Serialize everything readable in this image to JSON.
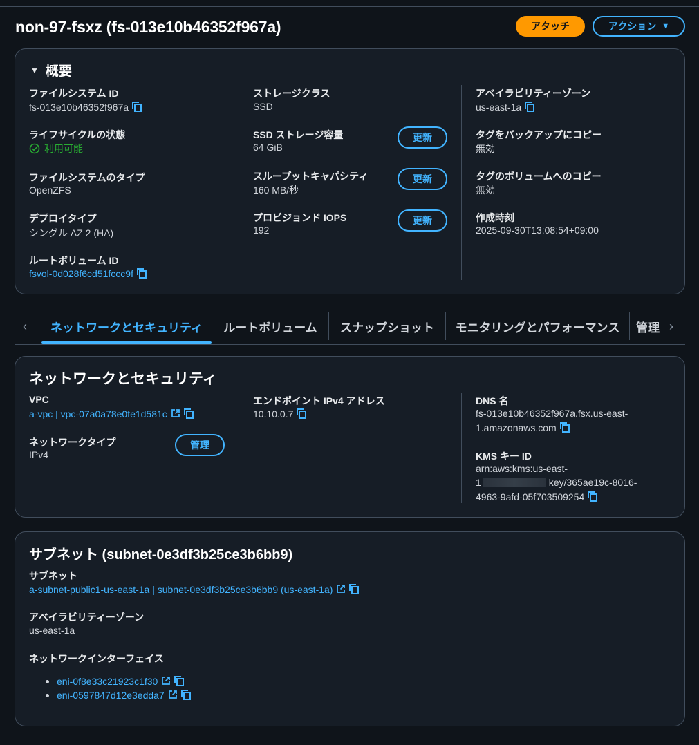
{
  "header": {
    "title": "non-97-fsxz (fs-013e10b46352f967a)",
    "attach_label": "アタッチ",
    "actions_label": "アクション"
  },
  "summary": {
    "heading": "概要",
    "col1": {
      "fs_id_label": "ファイルシステム ID",
      "fs_id_value": "fs-013e10b46352f967a",
      "lifecycle_label": "ライフサイクルの状態",
      "lifecycle_value": "利用可能",
      "fs_type_label": "ファイルシステムのタイプ",
      "fs_type_value": "OpenZFS",
      "deploy_label": "デプロイタイプ",
      "deploy_value": "シングル AZ 2 (HA)",
      "root_vol_label": "ルートボリューム ID",
      "root_vol_value": "fsvol-0d028f6cd51fccc9f"
    },
    "col2": {
      "storage_class_label": "ストレージクラス",
      "storage_class_value": "SSD",
      "ssd_capacity_label": "SSD ストレージ容量",
      "ssd_capacity_value": "64 GiB",
      "throughput_label": "スループットキャパシティ",
      "throughput_value": "160 MB/秒",
      "iops_label": "プロビジョンド IOPS",
      "iops_value": "192",
      "update_label": "更新"
    },
    "col3": {
      "az_label": "アベイラビリティーゾーン",
      "az_value": "us-east-1a",
      "backup_tags_label": "タグをバックアップにコピー",
      "backup_tags_value": "無効",
      "volume_tags_label": "タグのボリュームへのコピー",
      "volume_tags_value": "無効",
      "created_label": "作成時刻",
      "created_value": "2025-09-30T13:08:54+09:00"
    }
  },
  "tabs": [
    {
      "label": "ネットワークとセキュリティ"
    },
    {
      "label": "ルートボリューム"
    },
    {
      "label": "スナップショット"
    },
    {
      "label": "モニタリングとパフォーマンス"
    },
    {
      "label": "管理"
    }
  ],
  "network": {
    "heading": "ネットワークとセキュリティ",
    "vpc_label": "VPC",
    "vpc_value": "a-vpc | vpc-07a0a78e0fe1d581c",
    "net_type_label": "ネットワークタイプ",
    "net_type_value": "IPv4",
    "manage_label": "管理",
    "endpoint_label": "エンドポイント IPv4 アドレス",
    "endpoint_value": "10.10.0.7",
    "dns_label": "DNS 名",
    "dns_line1": "fs-013e10b46352f967a.fsx.us-east-",
    "dns_line2": "1.amazonaws.com",
    "kms_label": "KMS キー ID",
    "kms_line1": "arn:aws:kms:us-east-",
    "kms_line2_prefix": "1",
    "kms_line2_suffix": "key/365ae19c-8016-",
    "kms_line3": "4963-9afd-05f703509254"
  },
  "subnet": {
    "heading": "サブネット (subnet-0e3df3b25ce3b6bb9)",
    "subnet_label": "サブネット",
    "subnet_value": "a-subnet-public1-us-east-1a | subnet-0e3df3b25ce3b6bb9 (us-east-1a)",
    "az_label": "アベイラビリティーゾーン",
    "az_value": "us-east-1a",
    "eni_label": "ネットワークインターフェイス",
    "enis": [
      "eni-0f8e33c21923c1f30",
      "eni-0597847d12e3edda7"
    ]
  },
  "colors": {
    "background": "#0f141a",
    "panel": "#161d26",
    "link": "#42b4ff",
    "primary": "#ff9900",
    "success": "#29ad32"
  }
}
